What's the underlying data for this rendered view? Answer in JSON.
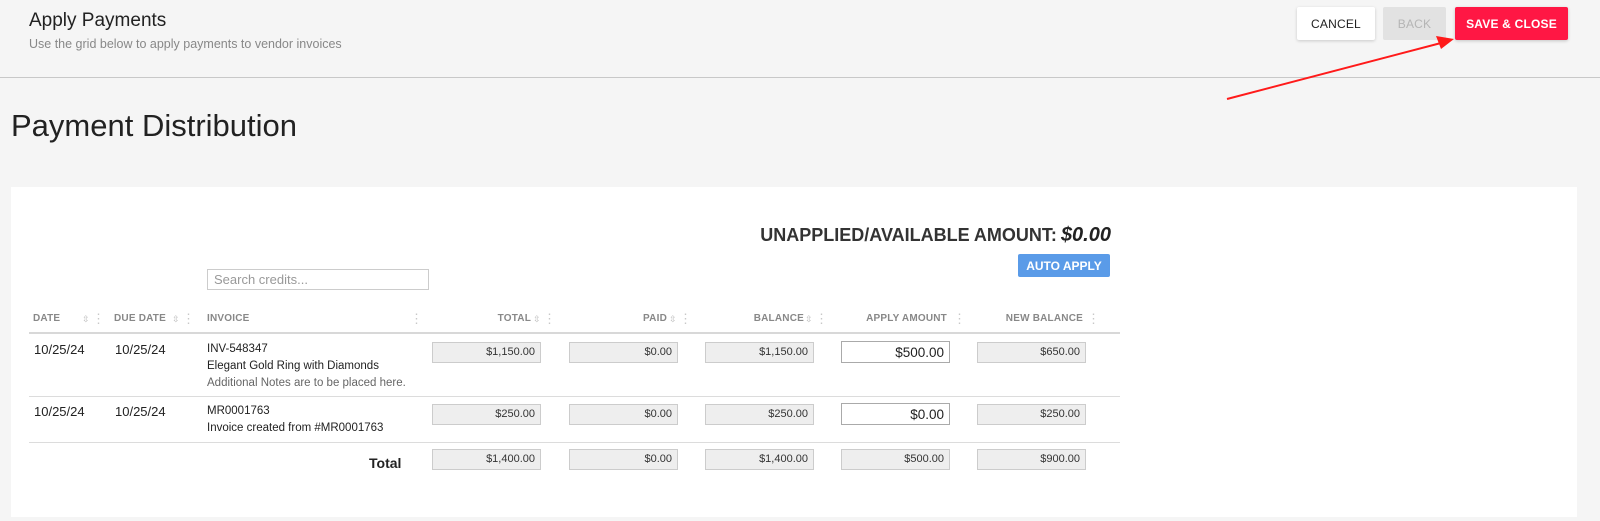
{
  "header": {
    "title": "Apply Payments",
    "subtitle": "Use the grid below to apply payments to vendor invoices",
    "cancel_label": "CANCEL",
    "back_label": "BACK",
    "save_label": "SAVE & CLOSE"
  },
  "section": {
    "title": "Payment Distribution"
  },
  "summary": {
    "label": "UNAPPLIED/AVAILABLE AMOUNT:",
    "amount": "$0.00",
    "auto_apply_label": "AUTO APPLY"
  },
  "search": {
    "placeholder": "Search credits..."
  },
  "columns": {
    "date": "DATE",
    "due_date": "DUE DATE",
    "invoice": "INVOICE",
    "total": "TOTAL",
    "paid": "PAID",
    "balance": "BALANCE",
    "apply_amount": "APPLY AMOUNT",
    "new_balance": "NEW BALANCE"
  },
  "rows": [
    {
      "date": "10/25/24",
      "due_date": "10/25/24",
      "invoice": "INV-548347",
      "description": "Elegant Gold Ring with Diamonds",
      "note": "Additional Notes are to be placed here.",
      "total": "$1,150.00",
      "paid": "$0.00",
      "balance": "$1,150.00",
      "apply_amount": "$500.00",
      "new_balance": "$650.00"
    },
    {
      "date": "10/25/24",
      "due_date": "10/25/24",
      "invoice": "MR0001763",
      "description": "Invoice created from #MR0001763",
      "total": "$250.00",
      "paid": "$0.00",
      "balance": "$250.00",
      "apply_amount": "$0.00",
      "new_balance": "$250.00"
    }
  ],
  "totals": {
    "label": "Total",
    "total": "$1,400.00",
    "paid": "$0.00",
    "balance": "$1,400.00",
    "apply_amount": "$500.00",
    "new_balance": "$900.00"
  },
  "annotation": {
    "arrow_color": "#ff1a1a"
  }
}
